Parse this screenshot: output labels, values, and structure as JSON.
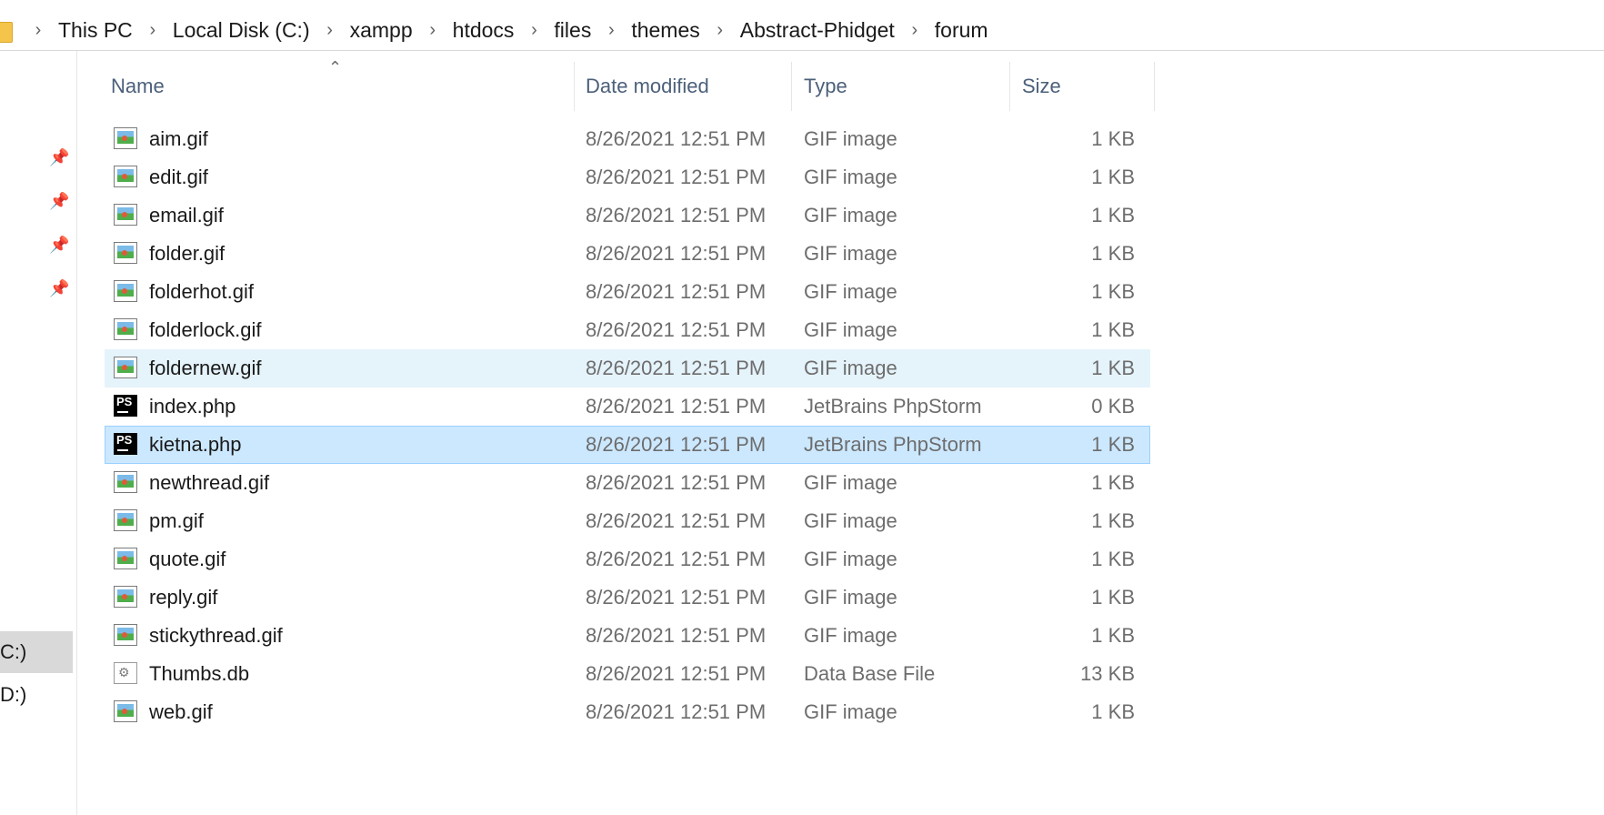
{
  "breadcrumb": [
    "This PC",
    "Local Disk (C:)",
    "xampp",
    "htdocs",
    "files",
    "themes",
    "Abstract-Phidget",
    "forum"
  ],
  "nav": {
    "drives": [
      {
        "label": "C:)",
        "selected": true
      },
      {
        "label": "D:)",
        "selected": false
      }
    ]
  },
  "columns": {
    "name": "Name",
    "date": "Date modified",
    "type": "Type",
    "size": "Size",
    "sort_indicator": "^"
  },
  "files": [
    {
      "name": "aim.gif",
      "date": "8/26/2021 12:51 PM",
      "type": "GIF image",
      "size": "1 KB",
      "icon": "gif-image-icon",
      "state": ""
    },
    {
      "name": "edit.gif",
      "date": "8/26/2021 12:51 PM",
      "type": "GIF image",
      "size": "1 KB",
      "icon": "gif-image-icon",
      "state": ""
    },
    {
      "name": "email.gif",
      "date": "8/26/2021 12:51 PM",
      "type": "GIF image",
      "size": "1 KB",
      "icon": "gif-image-icon",
      "state": ""
    },
    {
      "name": "folder.gif",
      "date": "8/26/2021 12:51 PM",
      "type": "GIF image",
      "size": "1 KB",
      "icon": "gif-image-icon",
      "state": ""
    },
    {
      "name": "folderhot.gif",
      "date": "8/26/2021 12:51 PM",
      "type": "GIF image",
      "size": "1 KB",
      "icon": "gif-image-icon",
      "state": ""
    },
    {
      "name": "folderlock.gif",
      "date": "8/26/2021 12:51 PM",
      "type": "GIF image",
      "size": "1 KB",
      "icon": "gif-image-icon",
      "state": ""
    },
    {
      "name": "foldernew.gif",
      "date": "8/26/2021 12:51 PM",
      "type": "GIF image",
      "size": "1 KB",
      "icon": "gif-image-icon",
      "state": "hover"
    },
    {
      "name": "index.php",
      "date": "8/26/2021 12:51 PM",
      "type": "JetBrains PhpStorm",
      "size": "0 KB",
      "icon": "phpstorm-icon",
      "state": ""
    },
    {
      "name": "kietna.php",
      "date": "8/26/2021 12:51 PM",
      "type": "JetBrains PhpStorm",
      "size": "1 KB",
      "icon": "phpstorm-icon",
      "state": "selected"
    },
    {
      "name": "newthread.gif",
      "date": "8/26/2021 12:51 PM",
      "type": "GIF image",
      "size": "1 KB",
      "icon": "gif-image-icon",
      "state": ""
    },
    {
      "name": "pm.gif",
      "date": "8/26/2021 12:51 PM",
      "type": "GIF image",
      "size": "1 KB",
      "icon": "gif-image-icon",
      "state": ""
    },
    {
      "name": "quote.gif",
      "date": "8/26/2021 12:51 PM",
      "type": "GIF image",
      "size": "1 KB",
      "icon": "gif-image-icon",
      "state": ""
    },
    {
      "name": "reply.gif",
      "date": "8/26/2021 12:51 PM",
      "type": "GIF image",
      "size": "1 KB",
      "icon": "gif-image-icon",
      "state": ""
    },
    {
      "name": "stickythread.gif",
      "date": "8/26/2021 12:51 PM",
      "type": "GIF image",
      "size": "1 KB",
      "icon": "gif-image-icon",
      "state": ""
    },
    {
      "name": "Thumbs.db",
      "date": "8/26/2021 12:51 PM",
      "type": "Data Base File",
      "size": "13 KB",
      "icon": "database-file-icon",
      "state": ""
    },
    {
      "name": "web.gif",
      "date": "8/26/2021 12:51 PM",
      "type": "GIF image",
      "size": "1 KB",
      "icon": "gif-image-icon",
      "state": ""
    }
  ],
  "colors": {
    "selection": "#cce8ff",
    "hover": "#e5f3fb",
    "header_text": "#4c607a"
  }
}
